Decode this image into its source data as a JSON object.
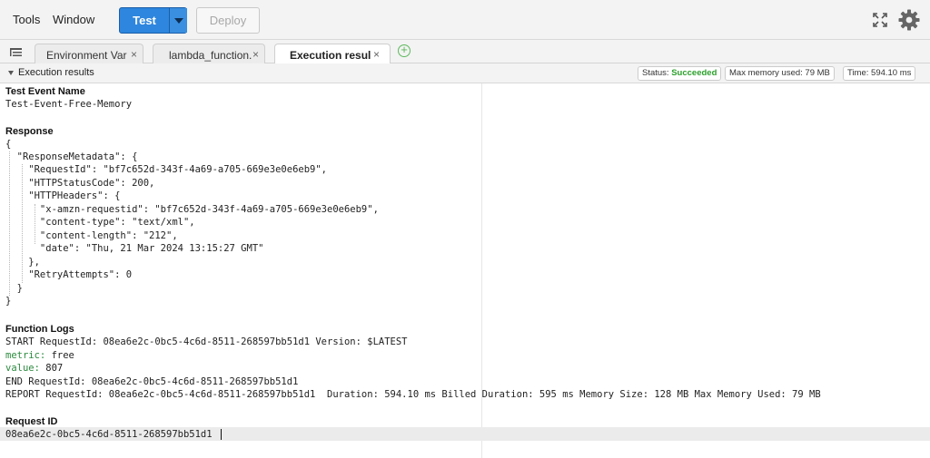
{
  "menu": {
    "tools": "Tools",
    "window": "Window"
  },
  "toolbar": {
    "test_label": "Test",
    "deploy_label": "Deploy"
  },
  "tabs": [
    {
      "label": "Environment Var",
      "active": false
    },
    {
      "label": "lambda_function.",
      "active": false
    },
    {
      "label": "Execution result",
      "active": true
    }
  ],
  "tab_close": "×",
  "tab_add": "+",
  "panel": {
    "title": "Execution results",
    "status_label": "Status:",
    "status_value": "Succeeded",
    "memory": "Max memory used: 79 MB",
    "time": "Time: 594.10 ms"
  },
  "sections": {
    "test_event_name": "Test Event Name",
    "response": "Response",
    "function_logs": "Function Logs",
    "request_id": "Request ID"
  },
  "test_event_value": "Test-Event-Free-Memory",
  "response_lines": [
    "{",
    "  \"ResponseMetadata\": {",
    "    \"RequestId\": \"bf7c652d-343f-4a69-a705-669e3e0e6eb9\",",
    "    \"HTTPStatusCode\": 200,",
    "    \"HTTPHeaders\": {",
    "      \"x-amzn-requestid\": \"bf7c652d-343f-4a69-a705-669e3e0e6eb9\",",
    "      \"content-type\": \"text/xml\",",
    "      \"content-length\": \"212\",",
    "      \"date\": \"Thu, 21 Mar 2024 13:15:27 GMT\"",
    "    },",
    "    \"RetryAttempts\": 0",
    "  }",
    "}"
  ],
  "logs": {
    "start": "START RequestId: 08ea6e2c-0bc5-4c6d-8511-268597bb51d1 Version: $LATEST",
    "metric_key": "metric:",
    "metric_value": " free",
    "value_key": "value:",
    "value_value": " 807",
    "end": "END RequestId: 08ea6e2c-0bc5-4c6d-8511-268597bb51d1",
    "report": "REPORT RequestId: 08ea6e2c-0bc5-4c6d-8511-268597bb51d1  Duration: 594.10 ms Billed Duration: 595 ms Memory Size: 128 MB Max Memory Used: 79 MB"
  },
  "request_id_value": "08ea6e2c-0bc5-4c6d-8511-268597bb51d1",
  "colors": {
    "accent": "#2e86de",
    "success": "#2ca02c",
    "log_key": "#2b8a3e"
  }
}
